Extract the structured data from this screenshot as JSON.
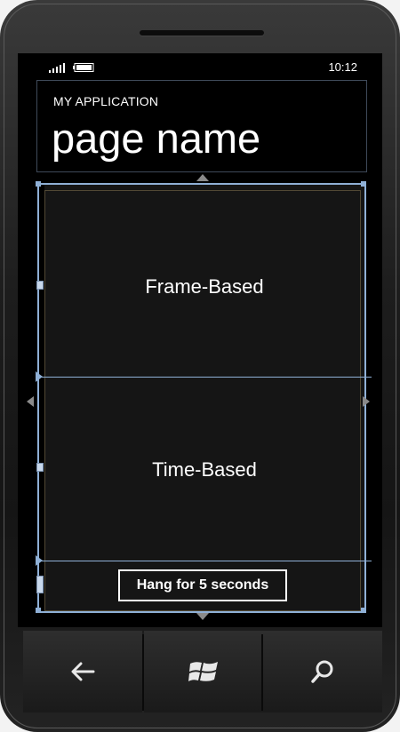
{
  "status_bar": {
    "time": "10:12",
    "signal_icon": "signal-bars-icon",
    "battery_icon": "battery-icon"
  },
  "header": {
    "app_title": "MY APPLICATION",
    "page_title": "page name"
  },
  "content": {
    "rows": [
      {
        "label": "Frame-Based"
      },
      {
        "label": "Time-Based"
      }
    ],
    "hang_button_label": "Hang for 5 seconds"
  },
  "hardware_buttons": [
    {
      "name": "back",
      "icon": "back-arrow-icon"
    },
    {
      "name": "start",
      "icon": "windows-logo-icon"
    },
    {
      "name": "search",
      "icon": "search-icon"
    }
  ],
  "colors": {
    "selection": "#8fb0d6",
    "background": "#000000",
    "text": "#ffffff"
  }
}
